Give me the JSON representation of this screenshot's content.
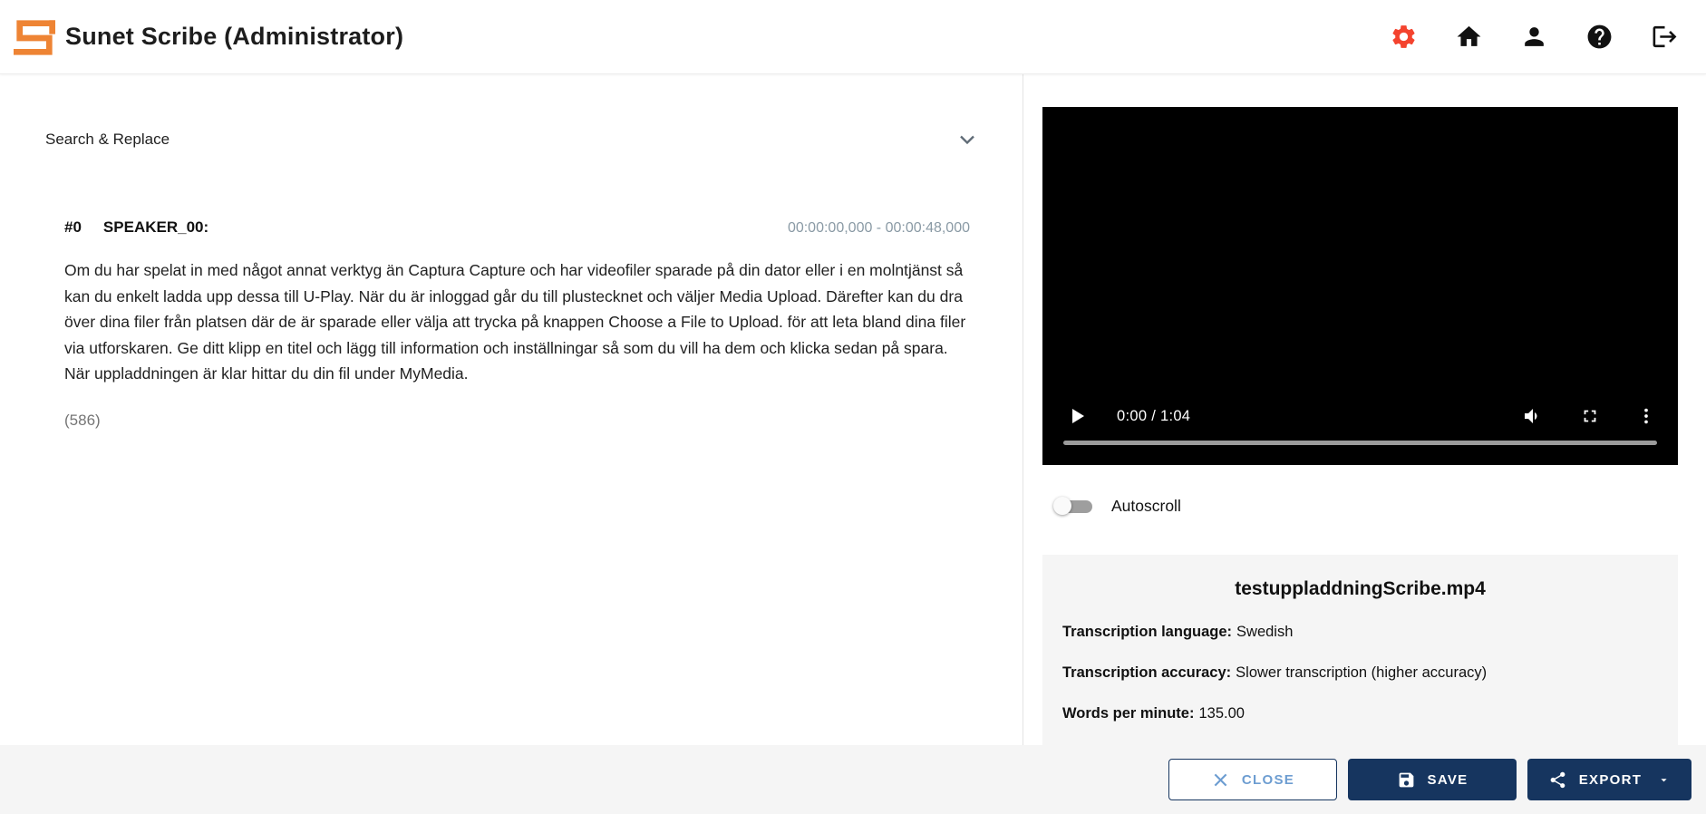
{
  "header": {
    "title": "Sunet Scribe (Administrator)",
    "icons": [
      "settings",
      "home",
      "profile",
      "help",
      "logout"
    ]
  },
  "transcript": {
    "search_replace_label": "Search & Replace",
    "segments": [
      {
        "index": "#0",
        "speaker": "SPEAKER_00:",
        "timerange": "00:00:00,000 - 00:00:48,000",
        "text": "Om du har spelat in med något annat verktyg än Captura Capture och har videofiler sparade på din dator eller i en molntjänst så kan du enkelt ladda upp dessa till U-Play. När du är inloggad går du till plustecknet och väljer Media Upload. Därefter kan du dra över dina filer från platsen där de är sparade eller välja att trycka på knappen Choose a File to Upload. för att leta bland dina filer via utforskaren. Ge ditt klipp en titel och lägg till information och inställningar så som du vill ha dem och klicka sedan på spara. När uppladdningen är klar hittar du din fil under MyMedia.",
        "char_count": "(586)"
      }
    ]
  },
  "player": {
    "time_display": "0:00 / 1:04",
    "progress_percent": 0
  },
  "autoscroll": {
    "label": "Autoscroll",
    "enabled": false
  },
  "media_info": {
    "filename": "testuppladdningScribe.mp4",
    "fields": [
      {
        "label": "Transcription language:",
        "value": "Swedish"
      },
      {
        "label": "Transcription accuracy:",
        "value": "Slower transcription (higher accuracy)"
      },
      {
        "label": "Words per minute:",
        "value": "135.00"
      }
    ]
  },
  "footer": {
    "close_label": "CLOSE",
    "save_label": "SAVE",
    "export_label": "EXPORT"
  },
  "colors": {
    "brand_orange": "#ee8434",
    "settings_red": "#f4432e",
    "navy_button": "#16355f",
    "close_text_blue": "#6d9dd1",
    "timestamp_gray": "#8a9aa5",
    "panel_gray": "#f5f5f5"
  }
}
